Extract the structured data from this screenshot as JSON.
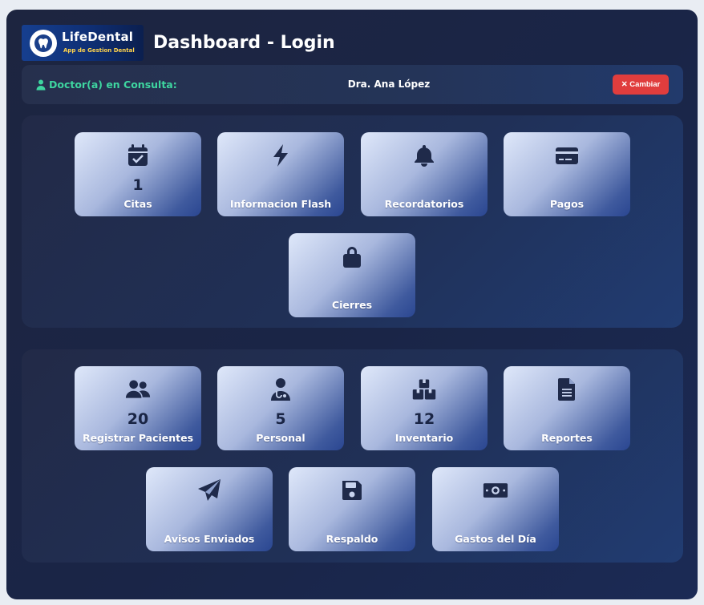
{
  "header": {
    "logo_brand": "LifeDental",
    "logo_tagline": "App de Gestion Dental",
    "title": "Dashboard - Login"
  },
  "doctor_bar": {
    "label": "Doctor(a) en Consulta:",
    "name": "Dra. Ana López",
    "change_button": "✕ Cambiar"
  },
  "panel1": {
    "cards": [
      {
        "id": "citas",
        "label": "Citas",
        "count": "1",
        "icon": "calendar-check-icon"
      },
      {
        "id": "informacion-flash",
        "label": "Informacion Flash",
        "count": "",
        "icon": "bolt-icon"
      },
      {
        "id": "recordatorios",
        "label": "Recordatorios",
        "count": "",
        "icon": "bell-icon"
      },
      {
        "id": "pagos",
        "label": "Pagos",
        "count": "",
        "icon": "credit-card-icon"
      },
      {
        "id": "cierres",
        "label": "Cierres",
        "count": "",
        "icon": "lock-icon"
      }
    ]
  },
  "panel2": {
    "cards": [
      {
        "id": "registrar-pacientes",
        "label": "Registrar Pacientes",
        "count": "20",
        "icon": "users-icon"
      },
      {
        "id": "personal",
        "label": "Personal",
        "count": "5",
        "icon": "user-doctor-icon"
      },
      {
        "id": "inventario",
        "label": "Inventario",
        "count": "12",
        "icon": "boxes-icon"
      },
      {
        "id": "reportes",
        "label": "Reportes",
        "count": "",
        "icon": "file-icon"
      },
      {
        "id": "avisos-enviados",
        "label": "Avisos Enviados",
        "count": "",
        "icon": "paper-plane-icon"
      },
      {
        "id": "respaldo",
        "label": "Respaldo",
        "count": "",
        "icon": "floppy-disk-icon"
      },
      {
        "id": "gastos-del-dia",
        "label": "Gastos del Día",
        "count": "",
        "icon": "money-bill-icon"
      }
    ]
  },
  "colors": {
    "accent_green": "#3ed6a0",
    "danger": "#e03d3d",
    "card_text": "#1e2a4d"
  }
}
